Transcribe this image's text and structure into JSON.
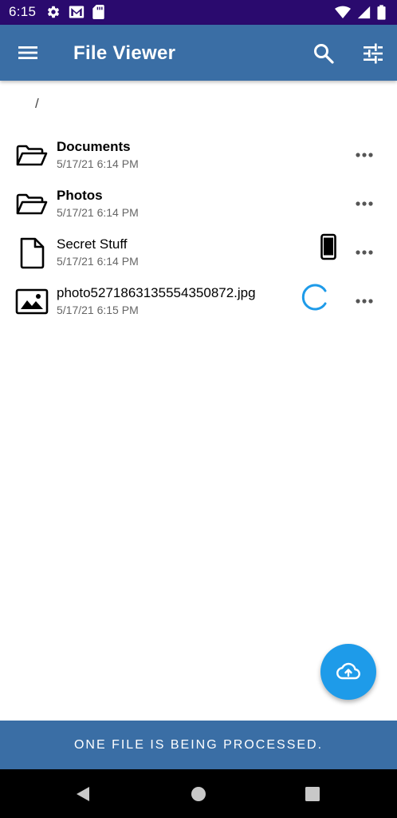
{
  "status_bar": {
    "time": "6:15",
    "left_icons": [
      "gear-icon",
      "gmail-icon",
      "sd-card-icon"
    ],
    "right_icons": [
      "wifi-icon",
      "signal-icon",
      "battery-icon"
    ]
  },
  "app_bar": {
    "title": "File Viewer",
    "menu_icon": "hamburger-menu-icon",
    "search_icon": "search-icon",
    "filter_icon": "tune-filter-icon",
    "background_color": "#3a6ea5"
  },
  "breadcrumb": {
    "path": "/"
  },
  "files": [
    {
      "name": "Documents",
      "date": "5/17/21 6:14 PM",
      "type": "folder",
      "icon": "folder-open-icon",
      "status": "",
      "more": "more-options-icon"
    },
    {
      "name": "Photos",
      "date": "5/17/21 6:14 PM",
      "type": "folder",
      "icon": "folder-open-icon",
      "status": "",
      "more": "more-options-icon"
    },
    {
      "name": "Secret Stuff",
      "date": "5/17/21 6:14 PM",
      "type": "file",
      "icon": "file-icon",
      "status": "phone-icon",
      "more": "more-options-icon"
    },
    {
      "name": "photo5271863135554350872.jpg",
      "date": "5/17/21 6:15 PM",
      "type": "image",
      "icon": "image-icon",
      "status": "loading-spinner-icon",
      "more": "more-options-icon"
    }
  ],
  "fab": {
    "icon": "cloud-upload-icon",
    "color": "#1e9be9"
  },
  "snackbar": {
    "message": "ONE FILE IS BEING PROCESSED."
  },
  "nav_bar": {
    "icons": [
      "back-icon",
      "home-icon",
      "recents-icon"
    ]
  }
}
